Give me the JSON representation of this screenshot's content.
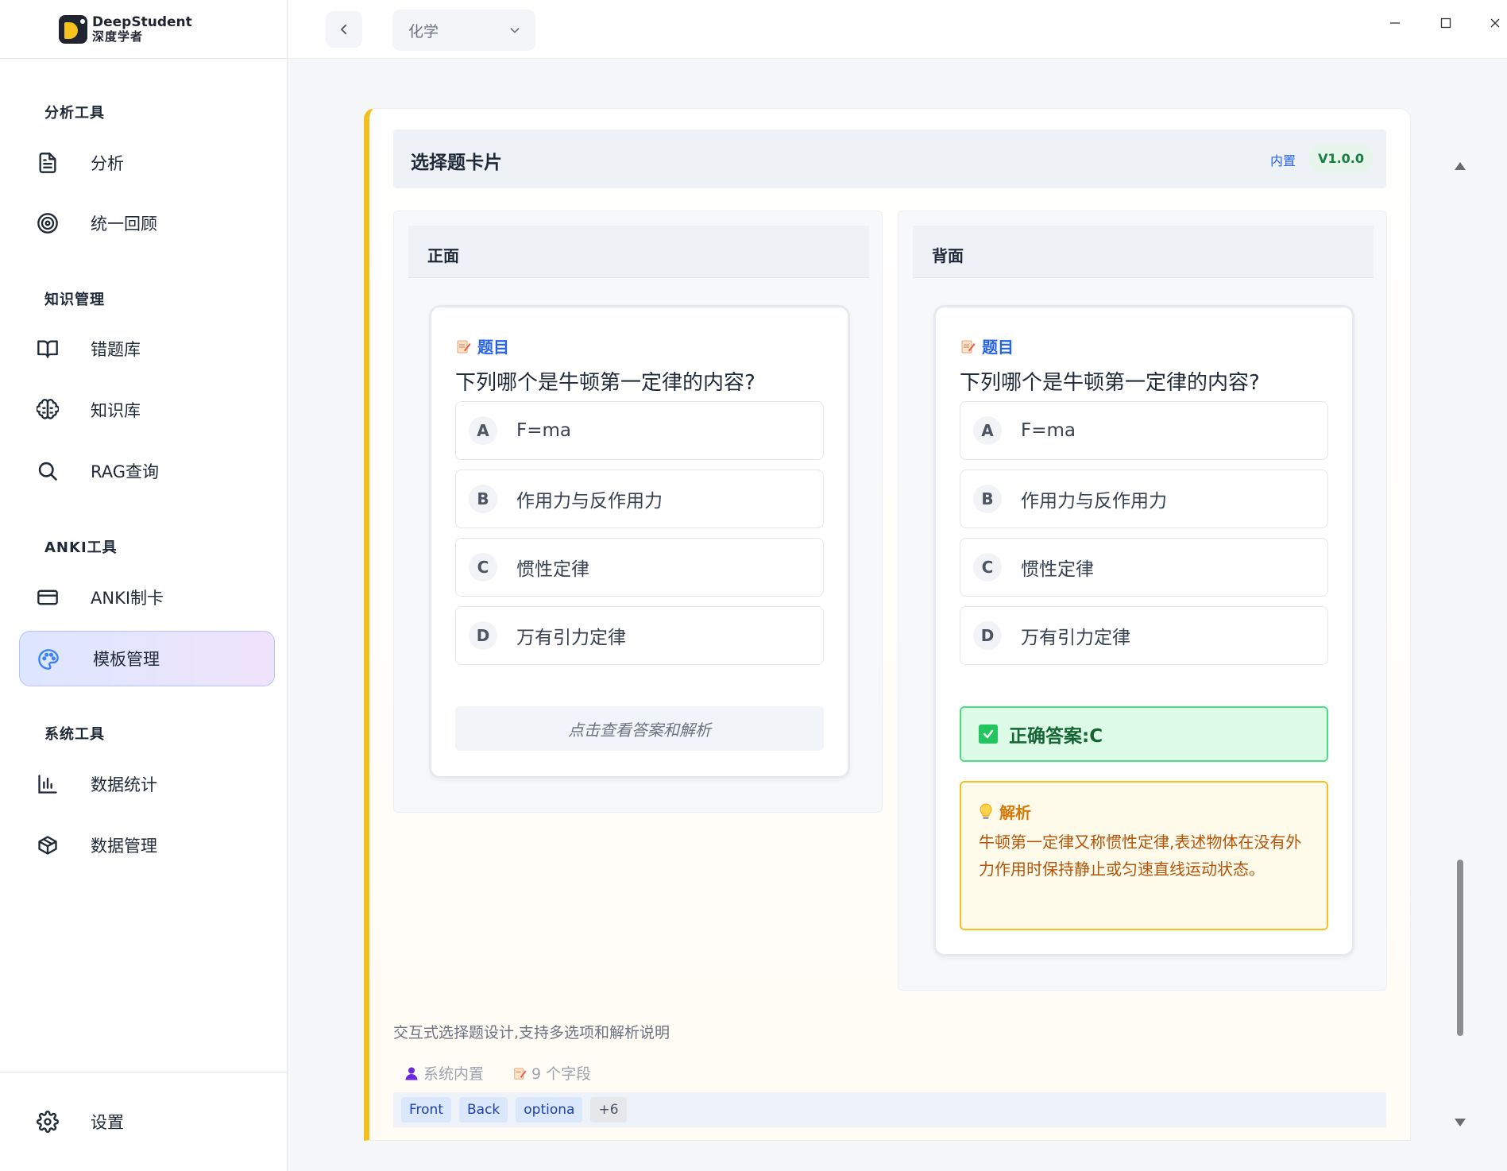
{
  "brand": {
    "name_en": "DeepStudent",
    "name_zh": "深度学者"
  },
  "sidebar": {
    "groups": [
      "分析工具",
      "知识管理",
      "ANKI工具",
      "系统工具"
    ],
    "items": [
      {
        "label": "分析",
        "icon": "document-icon"
      },
      {
        "label": "统一回顾",
        "icon": "target-icon"
      },
      {
        "label": "错题库",
        "icon": "book-icon"
      },
      {
        "label": "知识库",
        "icon": "brain-icon"
      },
      {
        "label": "RAG查询",
        "icon": "search-icon"
      },
      {
        "label": "ANKI制卡",
        "icon": "card-icon"
      },
      {
        "label": "模板管理",
        "icon": "palette-icon",
        "active": true
      },
      {
        "label": "数据统计",
        "icon": "bar-chart-icon"
      },
      {
        "label": "数据管理",
        "icon": "box-icon"
      }
    ],
    "settings_label": "设置"
  },
  "topbar": {
    "subject": "化学"
  },
  "template": {
    "title": "选择题卡片",
    "builtin": "内置",
    "version": "V1.0.0",
    "front": {
      "heading": "正面",
      "question_label": "题目",
      "question": "下列哪个是牛顿第一定律的内容?",
      "options": [
        {
          "letter": "A",
          "text": "F=ma"
        },
        {
          "letter": "B",
          "text": "作用力与反作用力"
        },
        {
          "letter": "C",
          "text": "惯性定律"
        },
        {
          "letter": "D",
          "text": "万有引力定律"
        }
      ],
      "reveal_text": "点击查看答案和解析"
    },
    "back": {
      "heading": "背面",
      "question_label": "题目",
      "question": "下列哪个是牛顿第一定律的内容?",
      "options": [
        {
          "letter": "A",
          "text": "F=ma"
        },
        {
          "letter": "B",
          "text": "作用力与反作用力"
        },
        {
          "letter": "C",
          "text": "惯性定律"
        },
        {
          "letter": "D",
          "text": "万有引力定律"
        }
      ],
      "answer": "正确答案:C",
      "explain_title": "解析",
      "explain_text": "牛顿第一定律又称惯性定律,表述物体在没有外力作用时保持静止或匀速直线运动状态。"
    },
    "description": "交互式选择题设计,支持多选项和解析说明",
    "author": "系统内置",
    "fields": "9 个字段",
    "tags": [
      "Front",
      "Back",
      "optiona"
    ],
    "tags_more": "+6"
  },
  "colors": {
    "accent": "#f3be1f",
    "primary": "#2563eb",
    "success": "#22c55e",
    "warning": "#fbbf24"
  }
}
